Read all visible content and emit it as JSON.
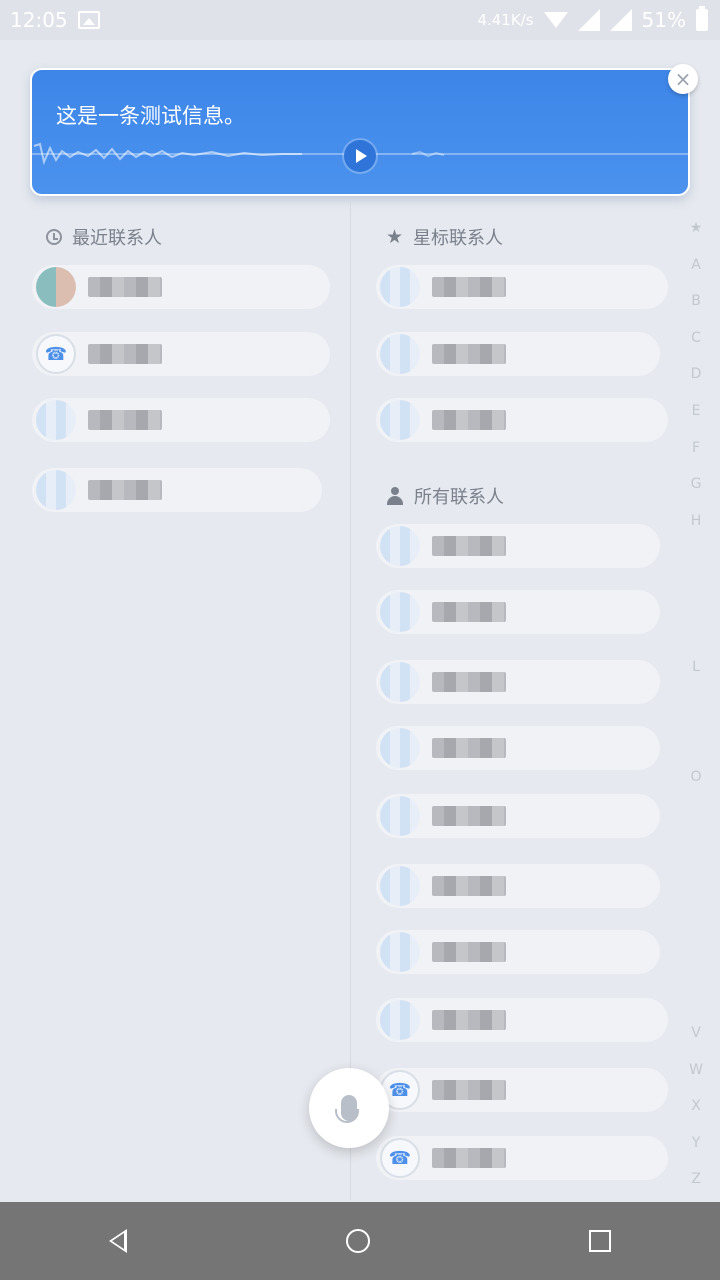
{
  "status_bar": {
    "time": "12:05",
    "network_speed": "4.41K/s",
    "battery": "51%",
    "icons": [
      "image-icon",
      "wifi-icon",
      "signal-icon",
      "signal-icon",
      "battery-icon"
    ]
  },
  "message": {
    "text": "这是一条测试信息。",
    "close_symbol": "×",
    "play_icon": "play-icon"
  },
  "sections": {
    "recent": "最近联系人",
    "starred": "星标联系人",
    "all": "所有联系人"
  },
  "contacts": {
    "recent": [
      "",
      "",
      "",
      ""
    ],
    "starred": [
      "",
      "",
      ""
    ],
    "all": [
      "",
      "",
      "",
      "",
      "",
      "",
      "",
      "",
      "",
      ""
    ]
  },
  "alphabet_index": [
    "A",
    "B",
    "C",
    "D",
    "E",
    "F",
    "G",
    "H",
    "",
    "",
    "",
    "L",
    "",
    "",
    "O",
    "",
    "",
    "",
    "",
    "",
    "",
    "V",
    "W",
    "X",
    "Y",
    "Z"
  ],
  "colors": {
    "accent": "#3d86e8",
    "background": "#e6e9ef",
    "navbar": "#757575"
  }
}
